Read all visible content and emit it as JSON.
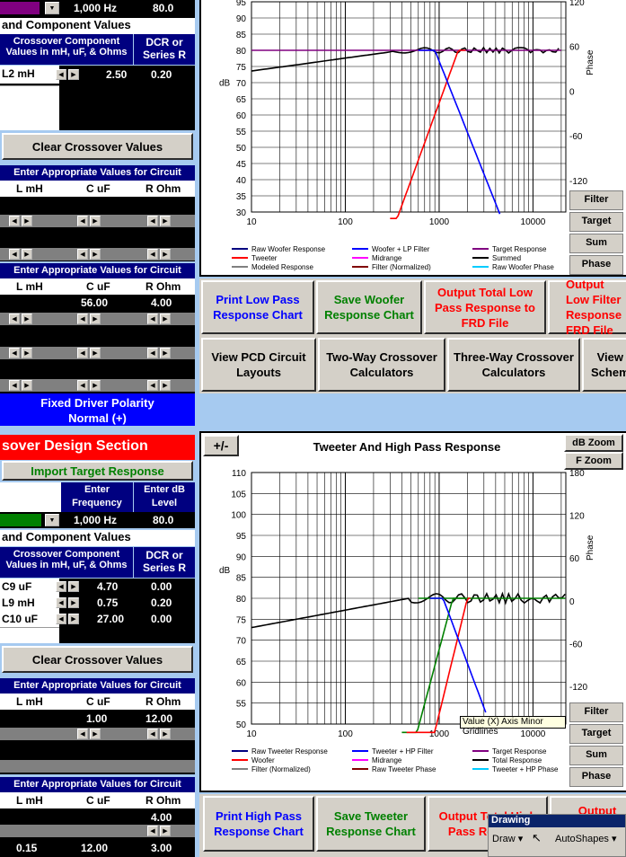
{
  "top": {
    "freq": "1,000 Hz",
    "level": "80.0",
    "section_title": "and Component Values",
    "col_comp": "Crossover Component Values in mH, uF, & Ohms",
    "col_dcr": "DCR or Series R",
    "row1_label": "L2 mH",
    "row1_val": "2.50",
    "row1_dcr": "0.20",
    "clear_label": "Clear Crossover Values",
    "enter1": "Enter Appropriate Values for Circuit",
    "hdr_l": "L mH",
    "hdr_c": "C uF",
    "hdr_r": "R Ohm",
    "enter2": "Enter Appropriate Values for Circuit",
    "hdr2_l": "L mH",
    "hdr2_c": "C uF",
    "hdr2_r": "R Ohm",
    "c2_val": "56.00",
    "r2_val": "4.00",
    "polarity_line1": "Fixed Driver Polarity",
    "polarity_line2": "Normal (+)"
  },
  "chart1": {
    "yticks": [
      "95",
      "90",
      "85",
      "80",
      "75",
      "70",
      "65",
      "60",
      "55",
      "50",
      "45",
      "40",
      "35",
      "30"
    ],
    "phase_ticks": [
      "120",
      "60",
      "0",
      "-60",
      "-120"
    ],
    "xticks": [
      "10",
      "100",
      "1000",
      "10000"
    ],
    "ylabel": "dB",
    "phase_label": "Phase",
    "legend": [
      "Raw Woofer Response",
      "Woofer + LP Filter",
      "Target Response",
      "Tweeter",
      "Midrange",
      "Summed",
      "Modeled Response",
      "Filter (Normalized)",
      "Raw Woofer Phase"
    ],
    "side_buttons": [
      "Filter",
      "Target",
      "Sum",
      "Phase"
    ]
  },
  "row_buttons1": {
    "print": "Print Low Pass Response Chart",
    "save": "Save Woofer Response Chart",
    "output": "Output Total Low Pass Response to FRD File",
    "output2": "Output Low Filter Response FRD File"
  },
  "row_buttons2": {
    "view_pcd": "View PCD Circuit Layouts",
    "two_way": "Two-Way Crossover Calculators",
    "three_way": "Three-Way Crossover Calculators",
    "view_sch": "View Schem"
  },
  "section2": {
    "title": "sover Design Section",
    "import": "Import Target Response",
    "enter_freq": "Enter Frequency",
    "enter_db": "Enter dB Level",
    "freq": "1,000 Hz",
    "level": "80.0",
    "values_title": "and Component Values",
    "col_comp": "Crossover Component Values in mH, uF, & Ohms",
    "col_dcr": "DCR or Series R",
    "rows": [
      {
        "label": "C9 uF",
        "val": "4.70",
        "dcr": "0.00"
      },
      {
        "label": "L9 mH",
        "val": "0.75",
        "dcr": "0.20"
      },
      {
        "label": "C10 uF",
        "val": "27.00",
        "dcr": "0.00"
      }
    ],
    "clear_label": "Clear Crossover Values",
    "enter1": "Enter Appropriate Values for Circuit",
    "hdr_l": "L mH",
    "hdr_c": "C uF",
    "hdr_r": "R Ohm",
    "c1_val": "1.00",
    "r1_val": "12.00",
    "enter2": "Enter Appropriate Values for Circuit",
    "hdr2_l": "L mH",
    "hdr2_c": "C uF",
    "hdr2_r": "R Ohm",
    "r2a_val": "4.00",
    "l2_val": "0.15",
    "c2_val": "12.00",
    "r2_val": "3.00"
  },
  "chart2": {
    "plusminus": "+/-",
    "title": "Tweeter  And High Pass Response",
    "db_zoom": "dB Zoom",
    "f_zoom": "F Zoom",
    "yticks": [
      "110",
      "105",
      "100",
      "95",
      "90",
      "85",
      "80",
      "75",
      "70",
      "65",
      "60",
      "55",
      "50"
    ],
    "phase_ticks": [
      "180",
      "120",
      "60",
      "0",
      "-60",
      "-120"
    ],
    "xticks": [
      "10",
      "100",
      "1000",
      "10000"
    ],
    "ylabel": "dB",
    "phase_label": "Phase",
    "tooltip": "Value (X) Axis Minor Gridlines",
    "legend": [
      "Raw Tweeter Response",
      "Tweeter + HP Filter",
      "Target Response",
      "Woofer",
      "Midrange",
      "Total Response",
      "Filter (Normalized)",
      "Raw Tweeter Phase",
      "Tweeter + HP Phase"
    ],
    "side_buttons": [
      "Filter",
      "Target",
      "Sum",
      "Phase"
    ]
  },
  "row_buttons3": {
    "print": "Print High Pass Response Chart",
    "save": "Save Tweeter Response Chart",
    "output": "Output Total High Pass Res FRD",
    "output2": "Output Hig"
  },
  "drawing": {
    "title": "Drawing",
    "draw": "Draw",
    "autoshapes": "AutoShapes"
  }
}
